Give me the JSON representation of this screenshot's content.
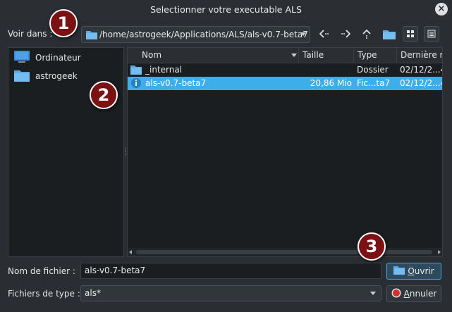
{
  "window": {
    "title": "Selectionner votre executable ALS"
  },
  "toolbar": {
    "look_in_label": "Voir dans :",
    "path": "/home/astrogeek/Applications/ALS/als-v0.7-beta7",
    "icons": [
      "back-icon",
      "forward-icon",
      "parent-directory-icon",
      "new-folder-icon",
      "icon-view-icon",
      "detail-view-icon"
    ]
  },
  "sidebar": {
    "items": [
      {
        "label": "Ordinateur",
        "icon": "computer-icon"
      },
      {
        "label": "astrogeek",
        "icon": "folder-icon"
      }
    ]
  },
  "filelist": {
    "columns": [
      "Nom",
      "Taille",
      "Type",
      "Dernière m"
    ],
    "rows": [
      {
        "name": "_internal",
        "size": "",
        "type": "Dossier",
        "date": "02/12/2...4",
        "icon": "folder-icon",
        "selected": false
      },
      {
        "name": "als-v0.7-beta7",
        "size": "20,86 Mio",
        "type": "Fic...ta7",
        "date": "02/12/2...4",
        "icon": "executable-file-icon",
        "selected": true
      }
    ]
  },
  "footer": {
    "filename_label": "Nom de fichier :",
    "filename_value": "als-v0.7-beta7",
    "filetype_label": "Fichiers de type :",
    "filetype_value": "als*",
    "open_label": "Ouvrir",
    "cancel_label": "Annuler",
    "open_mnemonic": "O",
    "cancel_mnemonic": "A"
  },
  "annotations": [
    "1",
    "2",
    "3"
  ],
  "colors": {
    "accent": "#3daee9",
    "badge": "#7b1113",
    "background": "#2a2e32"
  }
}
